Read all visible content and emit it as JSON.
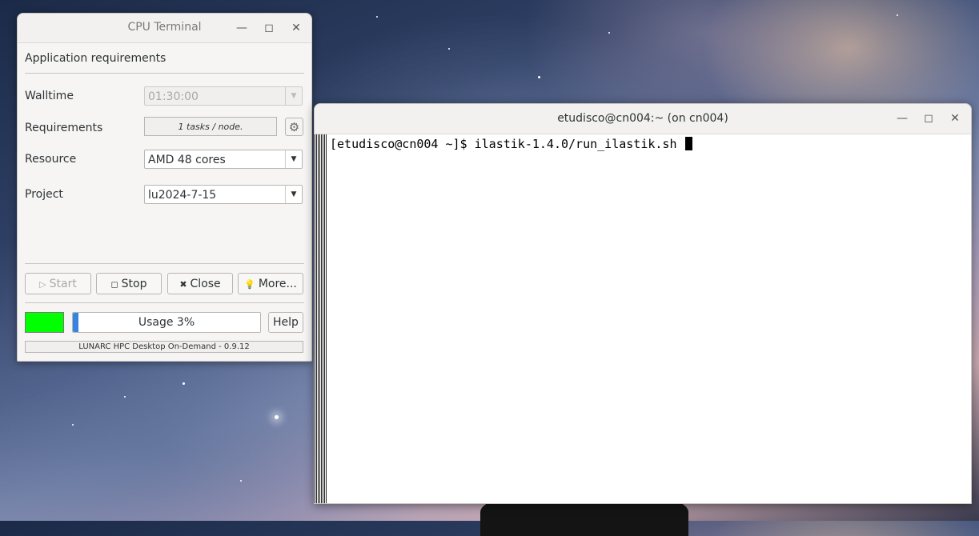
{
  "cpu_terminal": {
    "title": "CPU Terminal",
    "section_heading": "Application requirements",
    "walltime": {
      "label": "Walltime",
      "value": "01:30:00"
    },
    "requirements": {
      "label": "Requirements",
      "value": "1 tasks / node."
    },
    "resource": {
      "label": "Resource",
      "value": "AMD 48 cores"
    },
    "project": {
      "label": "Project",
      "value": "lu2024-7-15"
    },
    "buttons": {
      "start": "Start",
      "stop": "Stop",
      "close": "Close",
      "more": "More..."
    },
    "status_color": "#00ff00",
    "usage": {
      "label": "Usage 3%",
      "fraction": 0.03
    },
    "help": "Help",
    "footer": "LUNARC HPC Desktop On-Demand - 0.9.12"
  },
  "terminal": {
    "title": "etudisco@cn004:~ (on cn004)",
    "prompt": "[etudisco@cn004 ~]$ ",
    "command": "ilastik-1.4.0/run_ilastik.sh "
  },
  "icons": {
    "minimize": "minimize-icon",
    "maximize": "maximize-icon",
    "close": "close-icon",
    "gear": "gear-icon",
    "play": "play-icon",
    "stop": "stop-icon",
    "x": "x-icon",
    "bulb": "lightbulb-icon"
  }
}
